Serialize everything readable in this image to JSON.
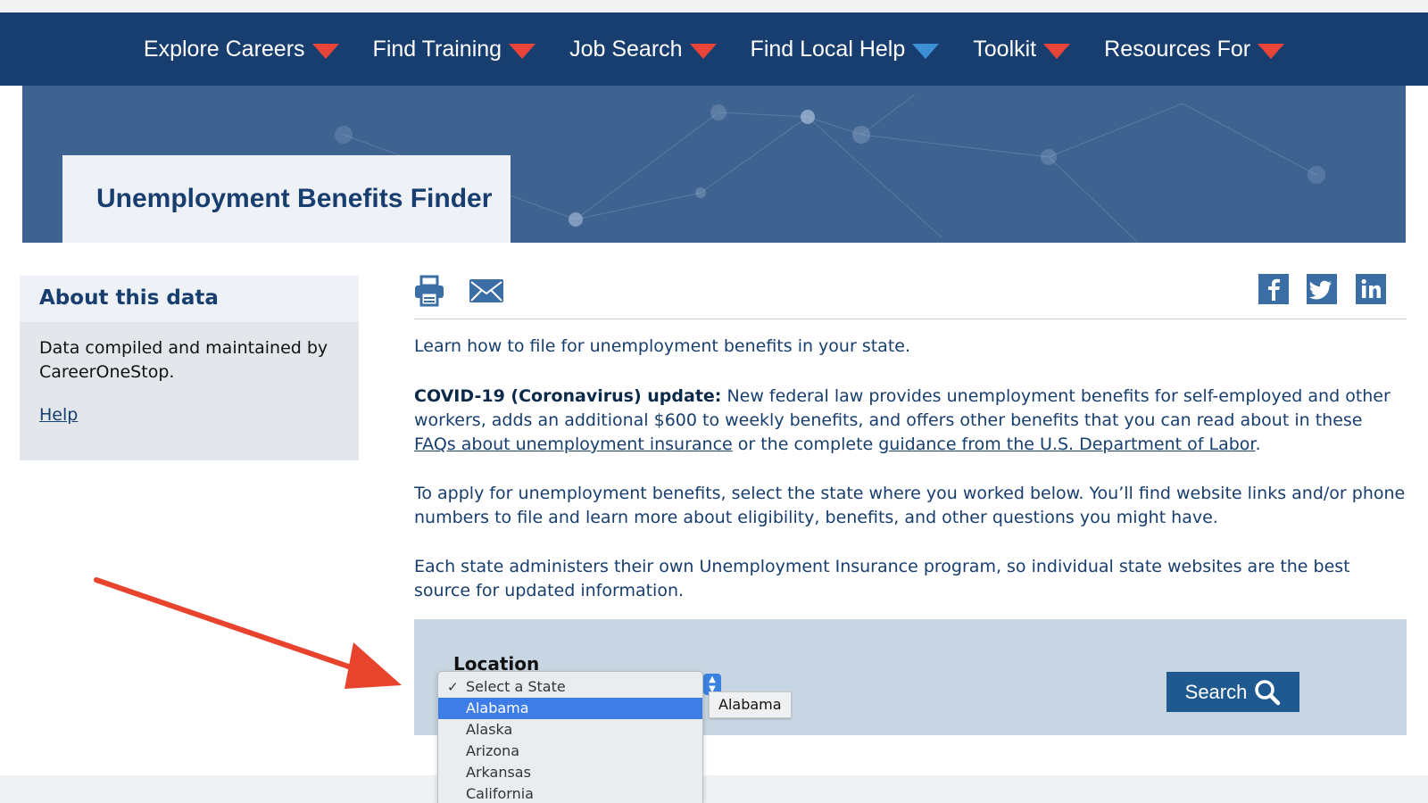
{
  "nav": {
    "items": [
      {
        "label": "Explore Careers",
        "caret": "red"
      },
      {
        "label": "Find Training",
        "caret": "red"
      },
      {
        "label": "Job Search",
        "caret": "red"
      },
      {
        "label": "Find Local Help",
        "caret": "blue"
      },
      {
        "label": "Toolkit",
        "caret": "red"
      },
      {
        "label": "Resources For",
        "caret": "red"
      }
    ]
  },
  "hero": {
    "title": "Unemployment Benefits Finder"
  },
  "sidebar": {
    "heading": "About this data",
    "body": "Data compiled and maintained by CareerOneStop.",
    "help_link": "Help"
  },
  "toolbar": {
    "icons": [
      "print-icon",
      "email-icon"
    ],
    "social": [
      "facebook-icon",
      "twitter-icon",
      "linkedin-icon"
    ]
  },
  "content": {
    "intro": "Learn how to file for unemployment benefits in your state.",
    "covid_bold": "COVID-19 (Coronavirus) update:",
    "covid_text_1": " New federal law provides unemployment benefits for self-employed and other workers, adds an additional $600 to weekly benefits, and offers other benefits that you can read about in these ",
    "covid_link_1": "FAQs about unemployment insurance",
    "covid_text_2": " or the complete ",
    "covid_link_2": "guidance from the U.S. Department of Labor",
    "covid_text_3": ".",
    "apply": "To apply for unemployment benefits, select the state where you worked below. You’ll find website links and/or phone numbers to file and learn more about eligibility, benefits, and other questions you might have.",
    "each_state": "Each state administers their own Unemployment Insurance program, so individual state websites are the best source for updated information."
  },
  "search_panel": {
    "location_label": "Location",
    "search_button": "Search",
    "dropdown": {
      "check_mark": "✓",
      "options": [
        "Select a State",
        "Alabama",
        "Alaska",
        "Arizona",
        "Arkansas",
        "California"
      ],
      "checked_option": "Select a State",
      "highlighted_option": "Alabama"
    },
    "tooltip": "Alabama"
  },
  "colors": {
    "nav_bg": "#173e6e",
    "caret_red": "#e8443a",
    "caret_blue": "#3d8fd6",
    "panel_bg": "#c8d6e3",
    "button_bg": "#1e5a8f",
    "highlight": "#3e7ce8",
    "annotation_arrow": "#e8432c"
  }
}
